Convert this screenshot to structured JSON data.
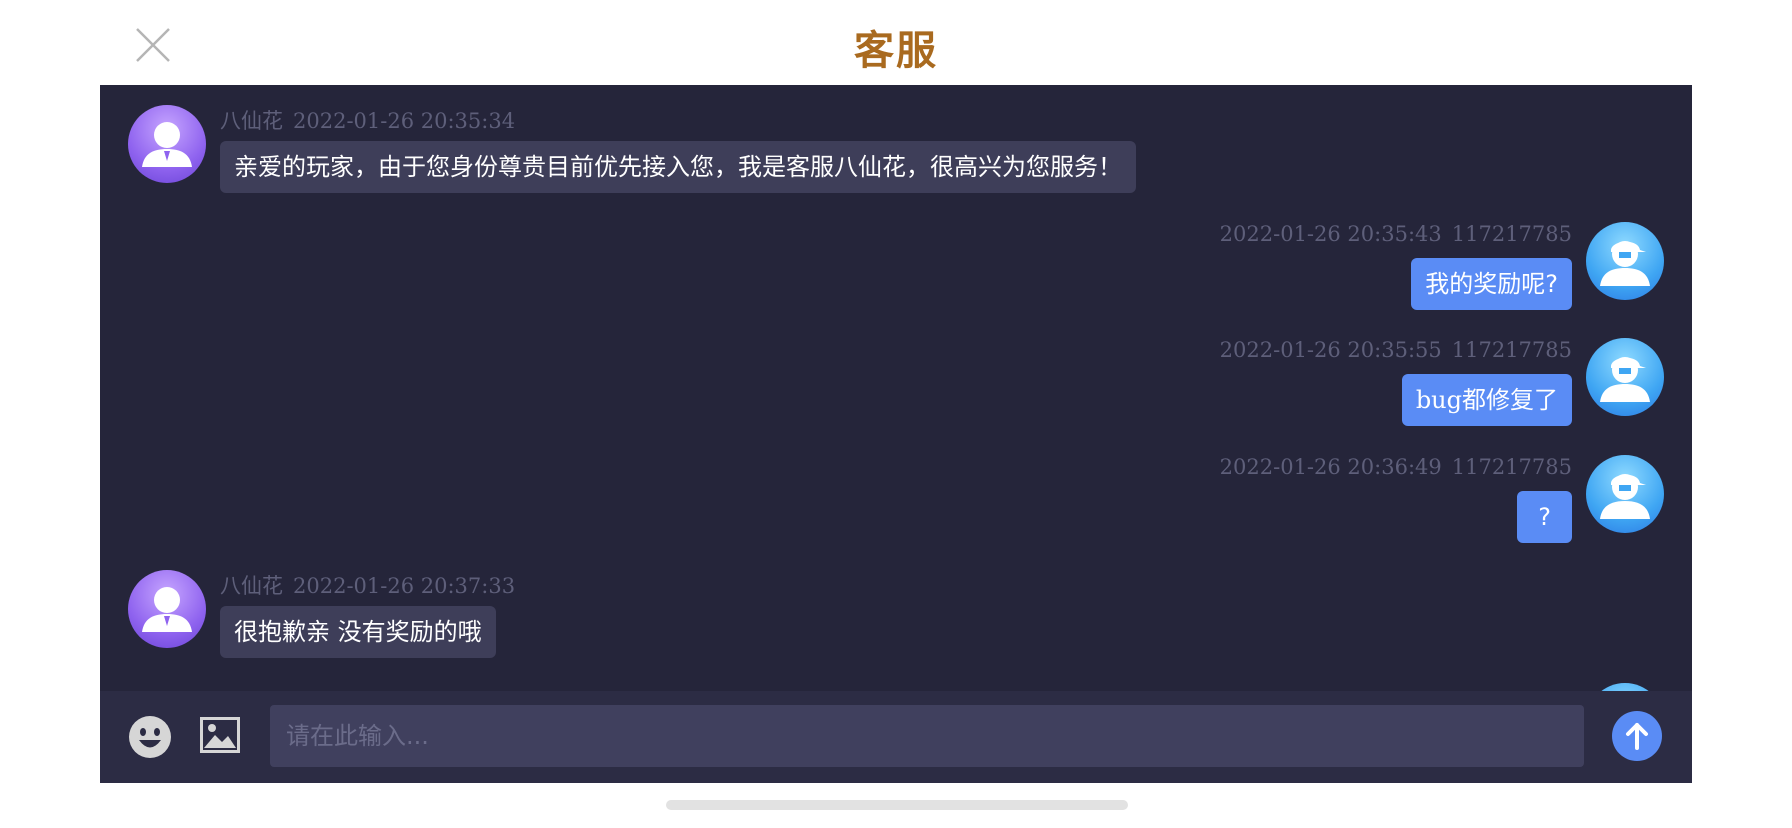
{
  "header": {
    "title": "客服",
    "close_icon": "close-icon"
  },
  "messages": [
    {
      "side": "left",
      "sender": "八仙花",
      "time": "2022-01-26 20:35:34",
      "text": "亲爱的玩家，由于您身份尊贵目前优先接入您，我是客服八仙花，很高兴为您服务！",
      "avatar_icon": "agent-avatar-icon"
    },
    {
      "side": "right",
      "sender": "117217785",
      "time": "2022-01-26 20:35:43",
      "text": "我的奖励呢?",
      "avatar_icon": "player-avatar-icon"
    },
    {
      "side": "right",
      "sender": "117217785",
      "time": "2022-01-26 20:35:55",
      "text": "bug都修复了",
      "avatar_icon": "player-avatar-icon"
    },
    {
      "side": "right",
      "sender": "117217785",
      "time": "2022-01-26 20:36:49",
      "text": "?",
      "avatar_icon": "player-avatar-icon"
    },
    {
      "side": "left",
      "sender": "八仙花",
      "time": "2022-01-26 20:37:33",
      "text": "很抱歉亲 没有奖励的哦",
      "avatar_icon": "agent-avatar-icon"
    }
  ],
  "input_bar": {
    "placeholder": "请在此输入...",
    "value": "",
    "emoji_icon": "emoji-icon",
    "image_icon": "image-icon",
    "send_icon": "arrow-up-icon"
  },
  "colors": {
    "title": "#a96a1f",
    "panel_bg": "#25253a",
    "agent_bubble": "#3e3e59",
    "player_bubble": "#5a8cf5",
    "meta_text": "#5e5f7a",
    "send_button": "#5a8cf5"
  }
}
